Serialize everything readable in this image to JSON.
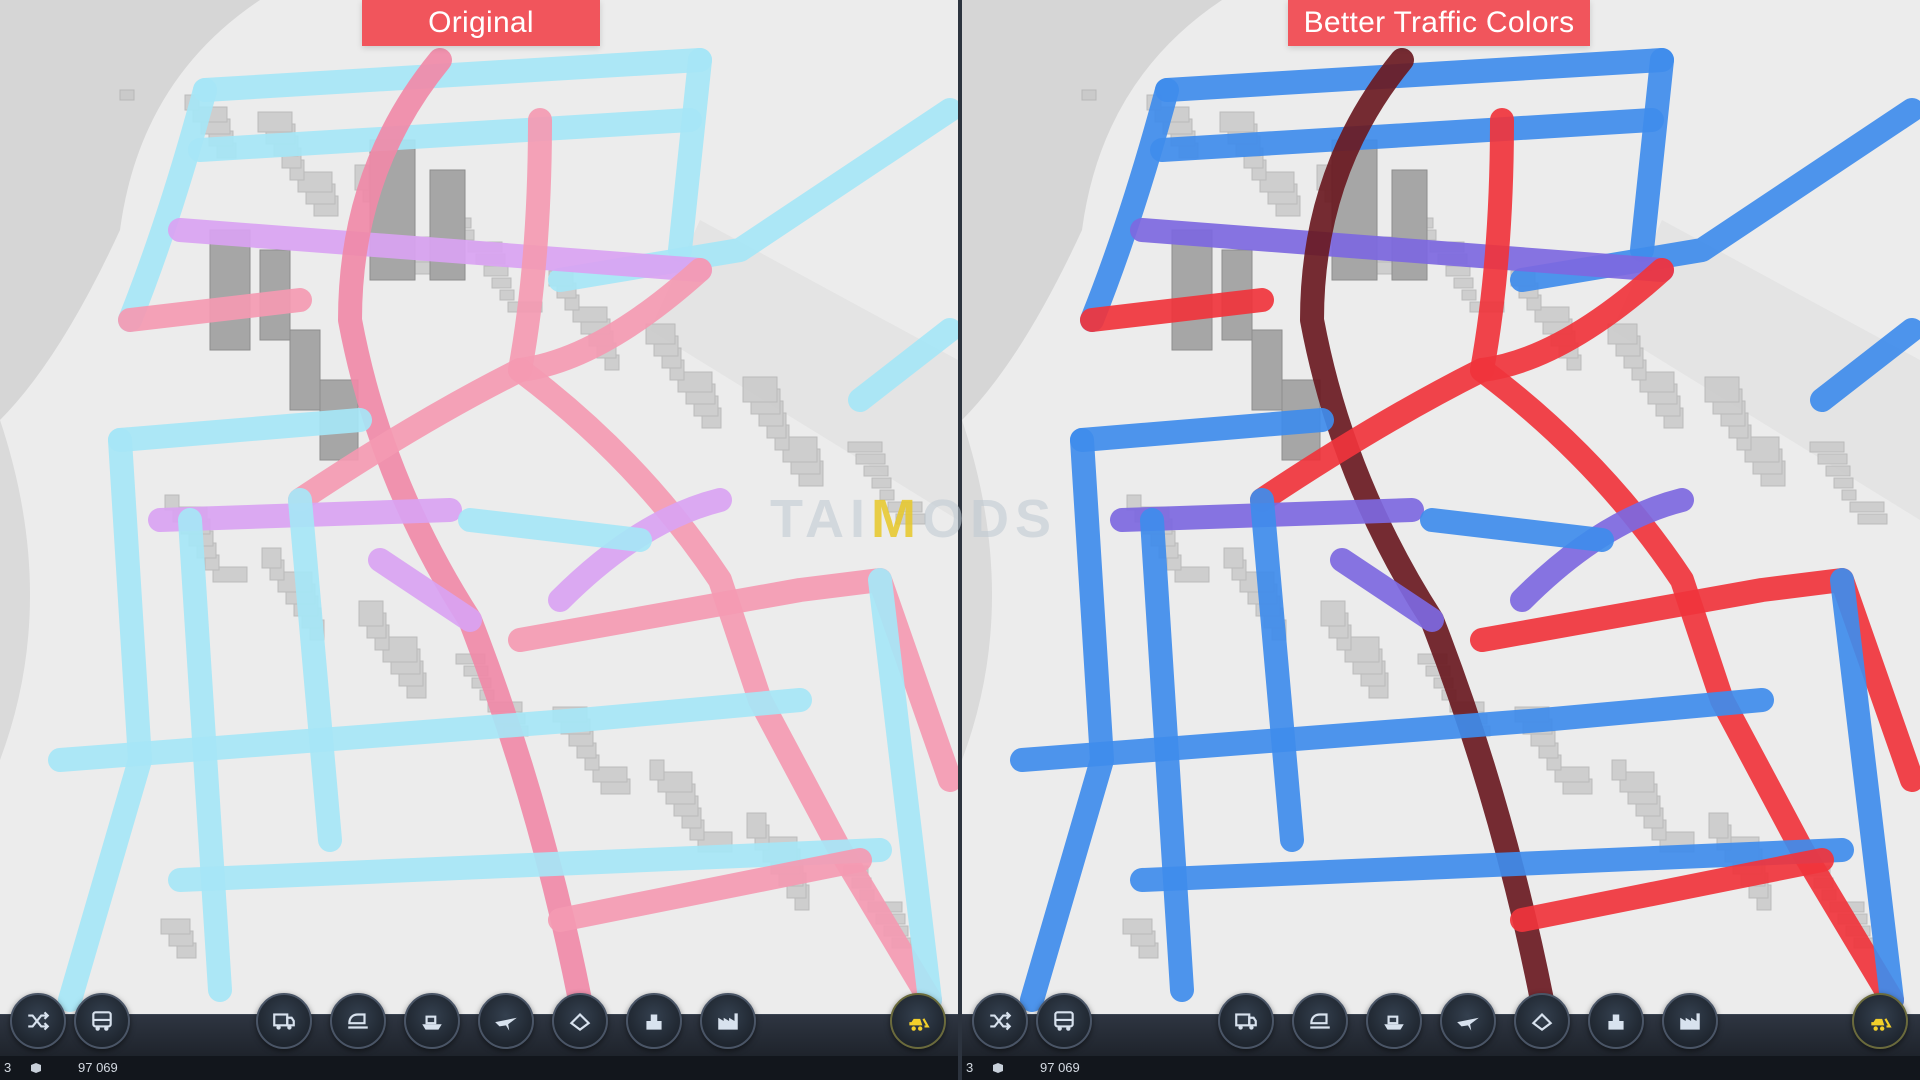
{
  "panels": [
    {
      "id": "left",
      "label": "Original",
      "colors": {
        "free": "#a6e6f6",
        "mid": "#d9a3f2",
        "busy": "#f49ab2",
        "jam": "#f08aa8"
      },
      "statusbar": {
        "count": "3",
        "money": "97 069"
      }
    },
    {
      "id": "right",
      "label": "Better Traffic Colors",
      "colors": {
        "free": "#3f8ceb",
        "mid": "#7d68e0",
        "busy": "#f0343c",
        "jam": "#6a1a22"
      },
      "statusbar": {
        "count": "3",
        "money": "97 069"
      }
    }
  ],
  "toolbar": {
    "buttons": [
      {
        "name": "shuffle-icon"
      },
      {
        "name": "bus-icon"
      },
      {
        "name": "truck-icon"
      },
      {
        "name": "train-icon"
      },
      {
        "name": "ship-icon"
      },
      {
        "name": "plane-icon"
      },
      {
        "name": "landmark-icon"
      },
      {
        "name": "monument-icon"
      },
      {
        "name": "industry-icon"
      },
      {
        "name": "bulldozer-icon"
      }
    ]
  },
  "watermark": {
    "text_a": "TAI",
    "text_m": "M",
    "text_b": "ODS"
  }
}
